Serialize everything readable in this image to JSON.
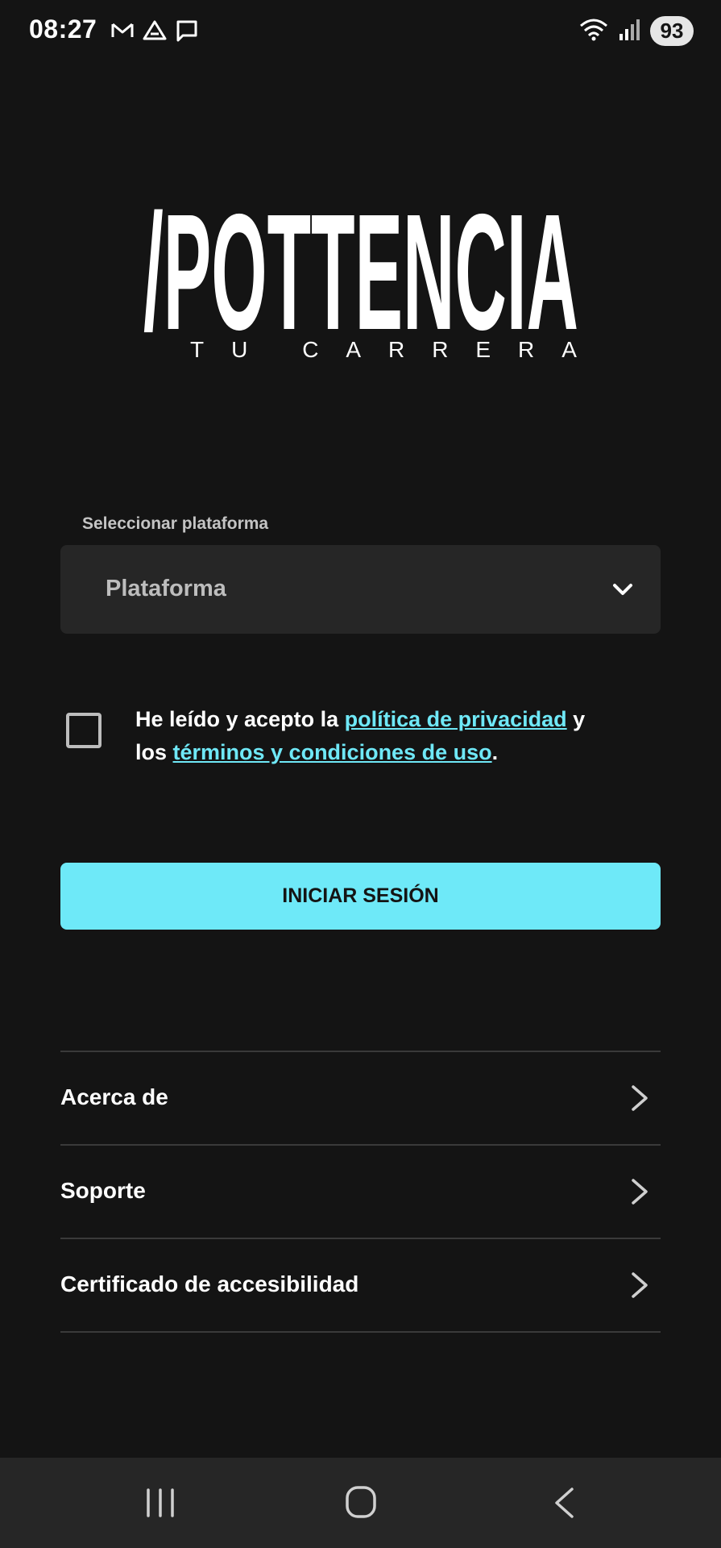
{
  "status_bar": {
    "time": "08:27",
    "left_icons": [
      "gmail-icon",
      "drive-icon",
      "message-icon"
    ],
    "right_icons": [
      "wifi-icon",
      "signal-icon"
    ],
    "battery": "93"
  },
  "logo": {
    "wordmark": "/POTTENCIA",
    "tagline_letters": [
      "T",
      "U",
      "",
      "C",
      "A",
      "R",
      "R",
      "E",
      "R",
      "A"
    ]
  },
  "platform": {
    "label": "Seleccionar plataforma",
    "placeholder": "Plataforma"
  },
  "consent": {
    "text_before": "He leído y acepto la ",
    "privacy_link": "política de privacidad",
    "text_middle": " y los ",
    "terms_link": "términos y condiciones de uso",
    "text_after": "."
  },
  "login_button": "INICIAR SESIÓN",
  "menu": [
    {
      "label": "Acerca de"
    },
    {
      "label": "Soporte"
    },
    {
      "label": "Certificado de accesibilidad"
    }
  ],
  "colors": {
    "background": "#141414",
    "accent": "#6ee9f8",
    "surface": "#262626"
  }
}
